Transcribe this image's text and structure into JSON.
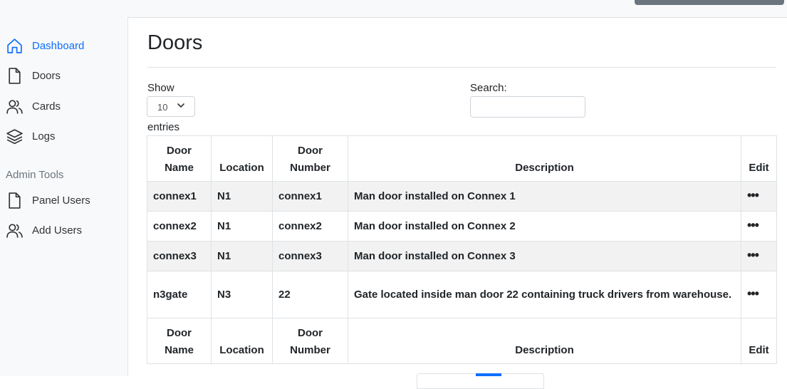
{
  "sidebar": {
    "items": [
      {
        "label": "Dashboard",
        "icon": "home-icon",
        "active": true
      },
      {
        "label": "Doors",
        "icon": "file-icon"
      },
      {
        "label": "Cards",
        "icon": "users-icon"
      },
      {
        "label": "Logs",
        "icon": "layers-icon"
      }
    ],
    "admin_heading": "Admin Tools",
    "admin_items": [
      {
        "label": "Panel Users",
        "icon": "file-icon"
      },
      {
        "label": "Add Users",
        "icon": "users-icon"
      }
    ]
  },
  "main": {
    "title": "Doors",
    "show_label": "Show",
    "entries_label": "entries",
    "length_value": "10",
    "search_label": "Search:",
    "search_value": ""
  },
  "table": {
    "columns": [
      "Door Name",
      "Location",
      "Door Number",
      "Description",
      "Edit"
    ],
    "rows": [
      {
        "name": "connex1",
        "location": "N1",
        "number": "connex1",
        "description": "Man door installed on Connex 1",
        "edit": "•••"
      },
      {
        "name": "connex2",
        "location": "N1",
        "number": "connex2",
        "description": "Man door installed on Connex 2",
        "edit": "•••"
      },
      {
        "name": "connex3",
        "location": "N1",
        "number": "connex3",
        "description": "Man door installed on Connex 3",
        "edit": "•••"
      },
      {
        "name": "n3gate",
        "location": "N3",
        "number": "22",
        "description": "Gate located inside man door 22 containing truck drivers from warehouse.",
        "edit": "•••"
      }
    ]
  },
  "colors": {
    "accent": "#0d6efd",
    "sidebar_bg": "#f8f9fa",
    "stripe": "#f2f2f2"
  }
}
